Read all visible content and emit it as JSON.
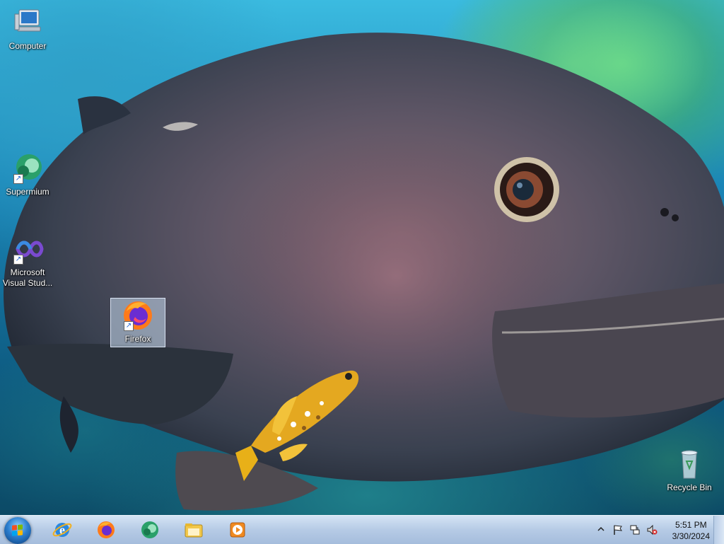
{
  "desktop": {
    "icons": [
      {
        "label": "Computer",
        "icon": "computer-icon",
        "shortcut": false
      },
      {
        "label": "Supermium",
        "icon": "supermium-icon",
        "shortcut": true
      },
      {
        "label": "Microsoft Visual Stud...",
        "icon": "visual-studio-icon",
        "shortcut": true
      },
      {
        "label": "Firefox",
        "icon": "firefox-icon",
        "shortcut": true,
        "selected": true
      },
      {
        "label": "Recycle Bin",
        "icon": "recycle-bin-icon",
        "shortcut": false
      }
    ]
  },
  "taskbar": {
    "pinned": [
      {
        "name": "Internet Explorer",
        "icon": "internet-explorer-icon"
      },
      {
        "name": "Firefox",
        "icon": "firefox-icon"
      },
      {
        "name": "Supermium",
        "icon": "supermium-icon"
      },
      {
        "name": "Windows Explorer",
        "icon": "folder-icon"
      },
      {
        "name": "Windows Media Player",
        "icon": "media-player-icon"
      }
    ],
    "tray": {
      "icons": [
        "show-hidden-icons-chevron",
        "action-center-flag-icon",
        "network-icon",
        "volume-muted-icon"
      ],
      "time": "5:51 PM",
      "date": "3/30/2024"
    }
  },
  "colors": {
    "taskbar": "#b8cde8",
    "selection": "#c8dcf0",
    "firefox_orange": "#ff7a1a",
    "firefox_purple": "#6a2dd1"
  }
}
